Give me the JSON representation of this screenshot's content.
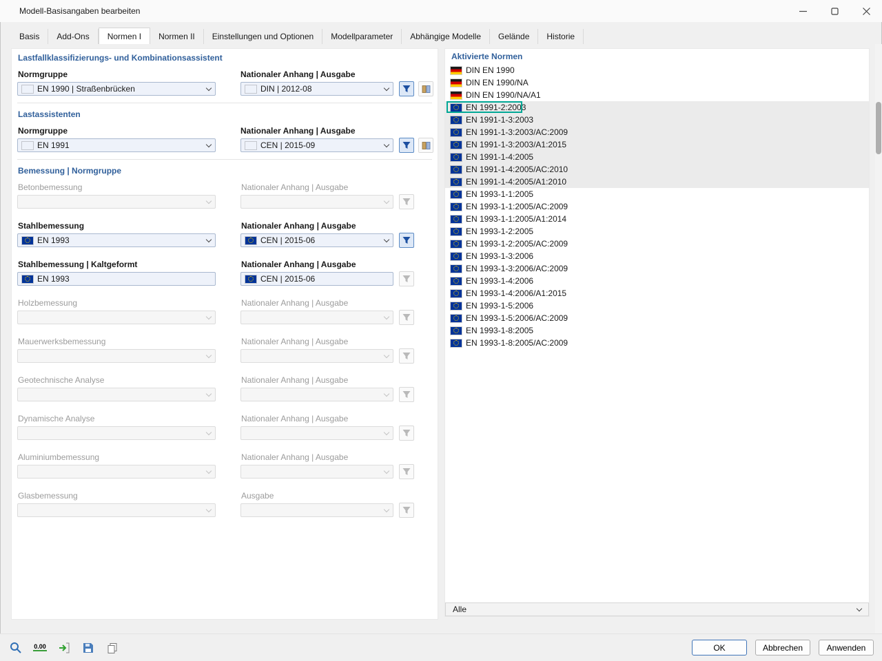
{
  "window": {
    "title": "Modell-Basisangaben bearbeiten"
  },
  "tabs": [
    "Basis",
    "Add-Ons",
    "Normen I",
    "Normen II",
    "Einstellungen und Optionen",
    "Modellparameter",
    "Abhängige Modelle",
    "Gelände",
    "Historie"
  ],
  "active_tab": "Normen I",
  "left": {
    "section1": {
      "heading": "Lastfallklassifizierungs- und Kombinationsassistent",
      "norm_label": "Normgruppe",
      "na_label": "Nationaler Anhang | Ausgabe",
      "norm_value": "EN 1990 | Straßenbrücken",
      "norm_flag": "eu",
      "na_value": "DIN | 2012-08",
      "na_flag": "de"
    },
    "section2": {
      "heading": "Lastassistenten",
      "norm_label": "Normgruppe",
      "na_label": "Nationaler Anhang | Ausgabe",
      "norm_value": "EN 1991",
      "norm_flag": "eu",
      "na_value": "CEN | 2015-09",
      "na_flag": "eu"
    },
    "section3": {
      "heading": "Bemessung | Normgruppe",
      "rows": [
        {
          "label": "Betonbemessung",
          "state": "disabled",
          "na_label": "Nationaler Anhang | Ausgabe",
          "value": "",
          "na_value": "",
          "filter": "off"
        },
        {
          "label": "Stahlbemessung",
          "state": "enabled",
          "value": "EN 1993",
          "flag": "eu",
          "na_label": "Nationaler Anhang | Ausgabe",
          "na_value": "CEN | 2015-06",
          "na_flag": "eu",
          "filter": "active"
        },
        {
          "label": "Stahlbemessung | Kaltgeformt",
          "state": "readonly",
          "value": "EN 1993",
          "flag": "eu",
          "na_label": "Nationaler Anhang | Ausgabe",
          "na_value": "CEN | 2015-06",
          "na_flag": "eu",
          "filter": "off"
        },
        {
          "label": "Holzbemessung",
          "state": "disabled",
          "na_label": "Nationaler Anhang | Ausgabe",
          "value": "",
          "na_value": "",
          "filter": "off"
        },
        {
          "label": "Mauerwerksbemessung",
          "state": "disabled",
          "na_label": "Nationaler Anhang | Ausgabe",
          "value": "",
          "na_value": "",
          "filter": "off"
        },
        {
          "label": "Geotechnische Analyse",
          "state": "disabled",
          "na_label": "Nationaler Anhang | Ausgabe",
          "value": "",
          "na_value": "",
          "filter": "off"
        },
        {
          "label": "Dynamische Analyse",
          "state": "disabled",
          "na_label": "Nationaler Anhang | Ausgabe",
          "value": "",
          "na_value": "",
          "filter": "off"
        },
        {
          "label": "Aluminiumbemessung",
          "state": "disabled",
          "na_label": "Nationaler Anhang | Ausgabe",
          "value": "",
          "na_value": "",
          "filter": "off"
        },
        {
          "label": "Glasbemessung",
          "state": "disabled",
          "na_label": "Ausgabe",
          "value": "",
          "na_value": "",
          "filter": "off"
        }
      ]
    }
  },
  "right": {
    "heading": "Aktivierte Normen",
    "filter_value": "Alle",
    "items": [
      {
        "flag": "de",
        "label": "DIN EN 1990"
      },
      {
        "flag": "de",
        "label": "DIN EN 1990/NA"
      },
      {
        "flag": "de",
        "label": "DIN EN 1990/NA/A1"
      },
      {
        "flag": "eu",
        "label": "EN 1991-2:2003",
        "grouped": true,
        "highlighted": true
      },
      {
        "flag": "eu",
        "label": "EN 1991-1-3:2003",
        "grouped": true
      },
      {
        "flag": "eu",
        "label": "EN 1991-1-3:2003/AC:2009",
        "grouped": true
      },
      {
        "flag": "eu",
        "label": "EN 1991-1-3:2003/A1:2015",
        "grouped": true
      },
      {
        "flag": "eu",
        "label": "EN 1991-1-4:2005",
        "grouped": true
      },
      {
        "flag": "eu",
        "label": "EN 1991-1-4:2005/AC:2010",
        "grouped": true
      },
      {
        "flag": "eu",
        "label": "EN 1991-1-4:2005/A1:2010",
        "grouped": true
      },
      {
        "flag": "eu",
        "label": "EN 1993-1-1:2005"
      },
      {
        "flag": "eu",
        "label": "EN 1993-1-1:2005/AC:2009"
      },
      {
        "flag": "eu",
        "label": "EN 1993-1-1:2005/A1:2014"
      },
      {
        "flag": "eu",
        "label": "EN 1993-1-2:2005"
      },
      {
        "flag": "eu",
        "label": "EN 1993-1-2:2005/AC:2009"
      },
      {
        "flag": "eu",
        "label": "EN 1993-1-3:2006"
      },
      {
        "flag": "eu",
        "label": "EN 1993-1-3:2006/AC:2009"
      },
      {
        "flag": "eu",
        "label": "EN 1993-1-4:2006"
      },
      {
        "flag": "eu",
        "label": "EN 1993-1-4:2006/A1:2015"
      },
      {
        "flag": "eu",
        "label": "EN 1993-1-5:2006"
      },
      {
        "flag": "eu",
        "label": "EN 1993-1-5:2006/AC:2009"
      },
      {
        "flag": "eu",
        "label": "EN 1993-1-8:2005"
      },
      {
        "flag": "eu",
        "label": "EN 1993-1-8:2005/AC:2009"
      }
    ]
  },
  "footer": {
    "units_text": "0.00",
    "ok": "OK",
    "cancel": "Abbrechen",
    "apply": "Anwenden"
  },
  "colors": {
    "accent": "#2f6fb5",
    "annotation": "#00a795",
    "heading": "#31609b"
  }
}
